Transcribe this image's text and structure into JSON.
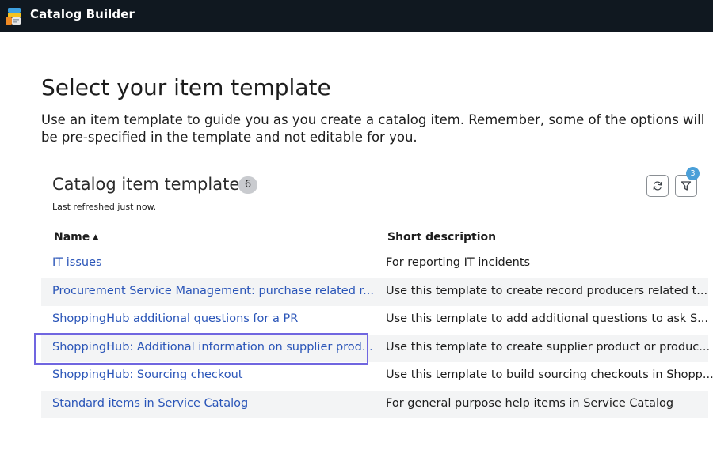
{
  "header": {
    "app_title": "Catalog Builder",
    "background_color": "#101820"
  },
  "page": {
    "title": "Select your item template",
    "description": "Use an item template to guide you as you create a catalog item. Remember, some of the options will be pre-specified in the template and not editable for you."
  },
  "list": {
    "title": "Catalog item templates",
    "count": "6",
    "last_refreshed": "Last refreshed just now.",
    "refresh_icon": "refresh-icon",
    "filter_icon": "filter-icon",
    "filter_count": "3",
    "columns": {
      "name": "Name",
      "short_description": "Short description"
    },
    "sort": "ascending",
    "rows": [
      {
        "name": "IT issues",
        "short_description": "For reporting IT incidents"
      },
      {
        "name": "Procurement Service Management: purchase related r...",
        "short_description": "Use this template to create record producers related t..."
      },
      {
        "name": "ShoppingHub additional questions for a PR",
        "short_description": "Use this template to add additional questions to ask S..."
      },
      {
        "name": "ShoppingHub: Additional information on supplier prod...",
        "short_description": "Use this template to create supplier product or produc..."
      },
      {
        "name": "ShoppingHub: Sourcing checkout",
        "short_description": "Use this template to build sourcing checkouts in Shopp..."
      },
      {
        "name": "Standard items in Service Catalog",
        "short_description": "For general purpose help items in Service Catalog"
      }
    ]
  },
  "colors": {
    "link": "#2a55b8",
    "focus": "#7066e0",
    "badge": "#4a9fd8"
  }
}
